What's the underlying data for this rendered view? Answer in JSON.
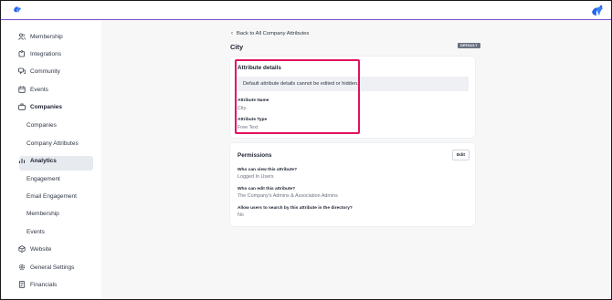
{
  "nav": {
    "membership": "Membership",
    "integrations": "Integrations",
    "community": "Community",
    "events": "Events",
    "companies": "Companies",
    "companies_sub": "Companies",
    "company_attributes": "Company Attributes",
    "analytics": "Analytics",
    "engagement": "Engagement",
    "email_engagement": "Email Engagement",
    "membership_sub": "Membership",
    "events_sub": "Events",
    "website": "Website",
    "general_settings": "General Settings",
    "financials": "Financials"
  },
  "main": {
    "back_label": "Back to All Company Attributes",
    "title": "City",
    "badge": "DEFAULT",
    "attribute_details": {
      "title": "Attribute details",
      "notice": "Default attribute details cannot be edited or hidden.",
      "name_label": "Attribute Name",
      "name_value": "City",
      "type_label": "Attribute Type",
      "type_value": "Free Text"
    },
    "permissions": {
      "title": "Permissions",
      "edit_label": "Edit",
      "view_label": "Who can view this attribute?",
      "view_value": "Logged In Users",
      "edit_who_label": "Who can edit this attribute?",
      "edit_who_value": "The Company's Admins & Association Admins",
      "search_label": "Allow users to search by this attribute in the directory?",
      "search_value": "No"
    }
  },
  "colors": {
    "accent": "#7c4fd6",
    "highlight": "#e0115f",
    "active_bg": "#e7eaef",
    "badge_bg": "#6b7280"
  }
}
